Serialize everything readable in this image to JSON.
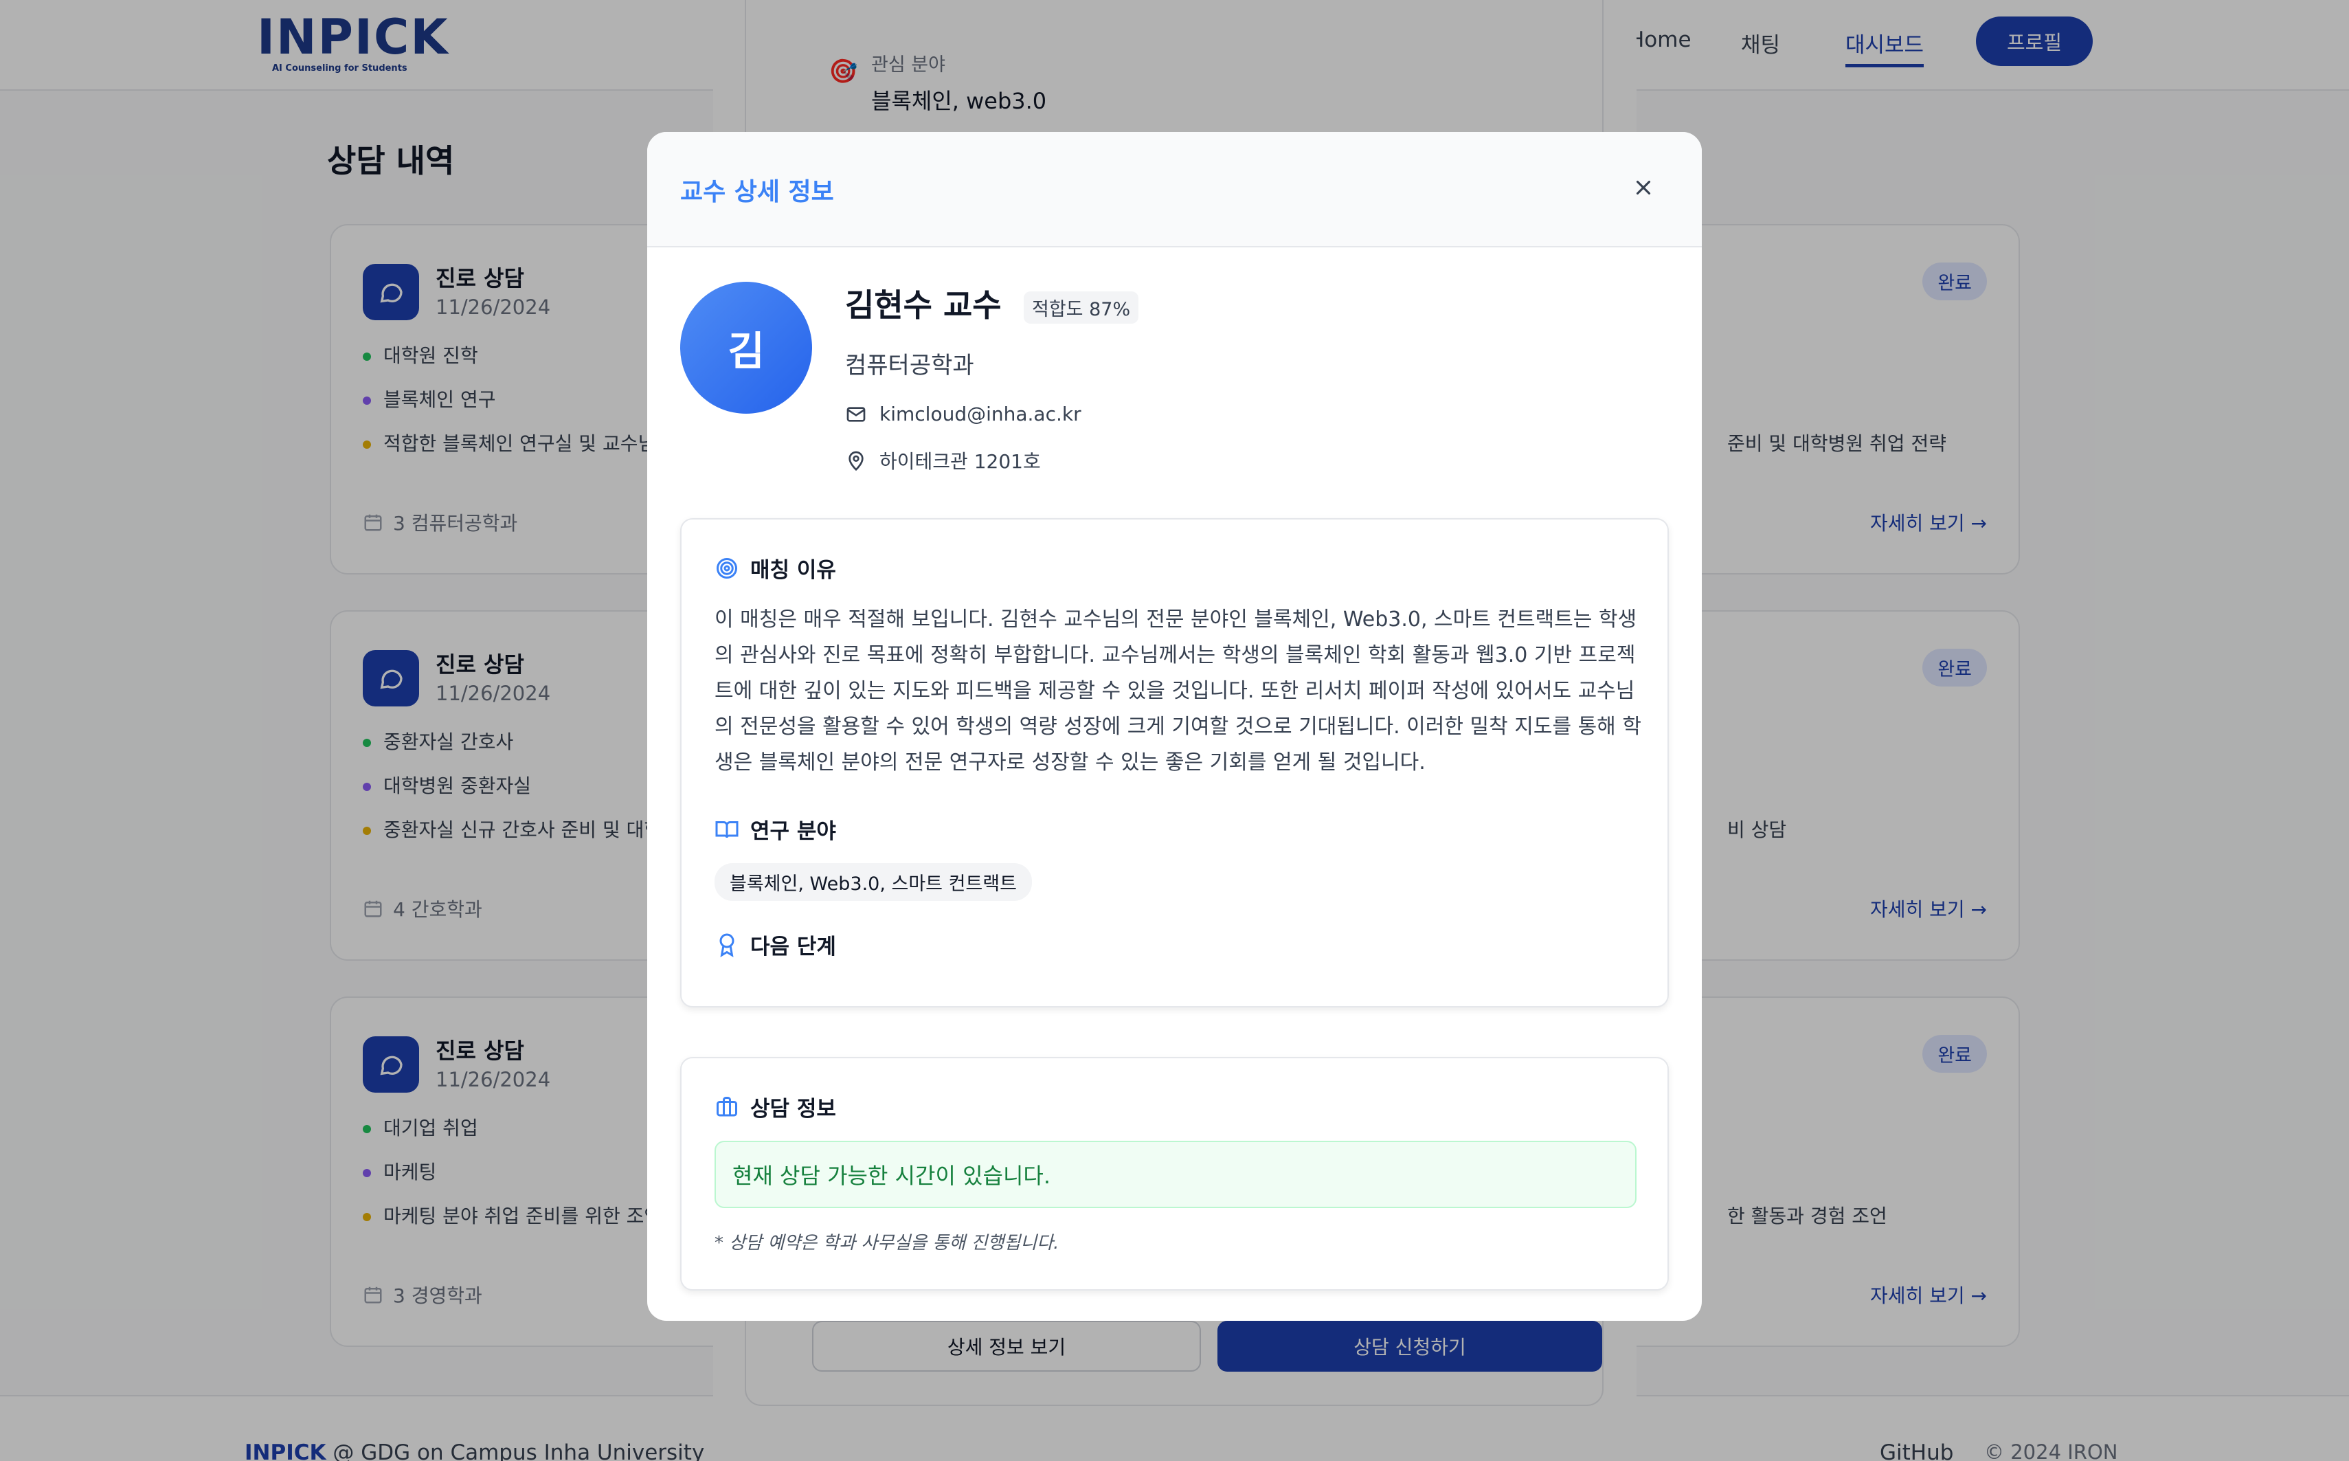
{
  "header": {
    "logo_text": "INPICK",
    "logo_sub": "AI Counseling for Students",
    "nav": [
      {
        "label": "Home"
      },
      {
        "label": "채팅"
      },
      {
        "label": "대시보드"
      }
    ],
    "profile_label": "프로필"
  },
  "page_title": "상담 내역",
  "cards": [
    {
      "title": "진로 상담",
      "date": "11/26/2024",
      "status": "완료",
      "items": [
        {
          "text": "대학원 진학",
          "color": "#22c55e"
        },
        {
          "text": "블록체인 연구",
          "color": "#8b5cf6"
        },
        {
          "text": "적합한 블록체인 연구실 및 교수님 찾",
          "right": "준비 및 대학병원 취업 전략",
          "color": "#eab308"
        }
      ],
      "footer": "3 컴퓨터공학과",
      "more": "자세히 보기 →"
    },
    {
      "title": "진로 상담",
      "date": "11/26/2024",
      "status": "완료",
      "items": [
        {
          "text": "중환자실 간호사",
          "color": "#22c55e"
        },
        {
          "text": "대학병원 중환자실",
          "color": "#8b5cf6"
        },
        {
          "text": "중환자실 신규 간호사 준비 및 대학병",
          "right": "비 상담",
          "color": "#eab308"
        }
      ],
      "footer": "4 간호학과",
      "more": "자세히 보기 →"
    },
    {
      "title": "진로 상담",
      "date": "11/26/2024",
      "status": "완료",
      "items": [
        {
          "text": "대기업 취업",
          "color": "#22c55e"
        },
        {
          "text": "마케팅",
          "color": "#8b5cf6"
        },
        {
          "text": "마케팅 분야 취업 준비를 위한 조언",
          "right": "한 활동과 경험 조언",
          "color": "#eab308"
        }
      ],
      "footer": "3 경영학과",
      "more": "자세히 보기 →"
    }
  ],
  "back_panel": {
    "interest_label": "관심 분야",
    "interest_value": "블록체인, web3.0",
    "detail_button": "상세 정보 보기",
    "apply_button": "상담 신청하기"
  },
  "footer": {
    "brand": "INPICK",
    "org": " @ GDG on Campus Inha University",
    "github": "GitHub",
    "copyright": "© 2024 IRON"
  },
  "modal": {
    "title": "교수 상세 정보",
    "avatar_initial": "김",
    "name": "김현수 교수",
    "match": "적합도 87%",
    "department": "컴퓨터공학과",
    "email": "kimcloud@inha.ac.kr",
    "office": "하이테크관 1201호",
    "reason_heading": "매칭 이유",
    "reason_text": "이 매칭은 매우 적절해 보입니다. 김현수 교수님의 전문 분야인 블록체인, Web3.0, 스마트 컨트랙트는 학생의 관심사와 진로 목표에 정확히 부합합니다. 교수님께서는 학생의 블록체인 학회 활동과 웹3.0 기반 프로젝트에 대한 깊이 있는 지도와 피드백을 제공할 수 있을 것입니다. 또한 리서치 페이퍼 작성에 있어서도 교수님의 전문성을 활용할 수 있어 학생의 역량 성장에 크게 기여할 것으로 기대됩니다. 이러한 밀착 지도를 통해 학생은 블록체인 분야의 전문 연구자로 성장할 수 있는 좋은 기회를 얻게 될 것입니다.",
    "research_heading": "연구 분야",
    "research_tag": "블록체인, Web3.0, 스마트 컨트랙트",
    "next_heading": "다음 단계",
    "consult_heading": "상담 정보",
    "availability": "현재 상담 가능한 시간이 있습니다.",
    "note": "* 상담 예약은 학과 사무실을 통해 진행됩니다."
  },
  "colors": {
    "primary": "#1e40af",
    "accent": "#3b82f6",
    "success_bg": "#f0fdf4",
    "success_text": "#15803d"
  },
  "icons": [
    "chat-bubble-icon",
    "calendar-icon",
    "arrow-right-icon",
    "target-icon",
    "close-icon",
    "mail-icon",
    "map-pin-icon",
    "book-open-icon",
    "award-icon",
    "briefcase-icon",
    "dart-icon"
  ]
}
